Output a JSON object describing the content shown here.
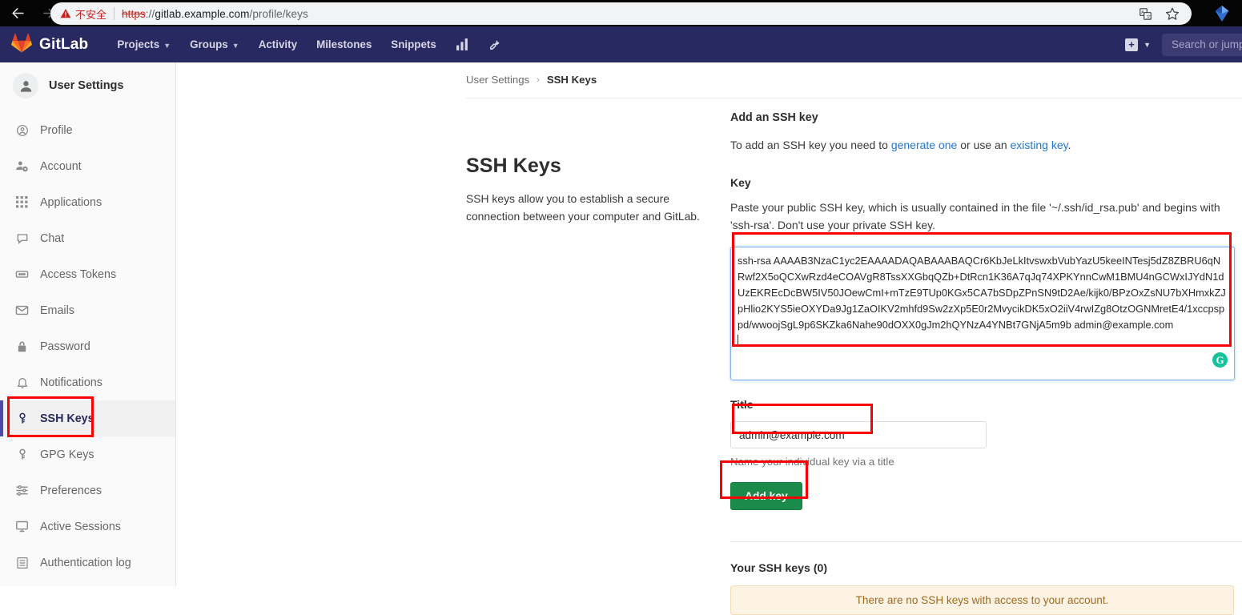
{
  "browser": {
    "back_icon": "back-arrow-icon",
    "forward_icon": "forward-arrow-icon",
    "reload_icon": "reload-icon",
    "security_warning": "不安全",
    "url_scheme": "https",
    "url_separator": "://",
    "url_host": "gitlab.example.com",
    "url_path": "/profile/keys",
    "translate_icon": "translate-icon",
    "bookmark_icon": "star-icon",
    "extension_icon": "extension-diamond-icon"
  },
  "navbar": {
    "brand": "GitLab",
    "logo_icon": "gitlab-tanuki-icon",
    "links": [
      {
        "label": "Projects",
        "caret": "⌄"
      },
      {
        "label": "Groups",
        "caret": "⌄"
      },
      {
        "label": "Activity",
        "caret": ""
      },
      {
        "label": "Milestones",
        "caret": ""
      },
      {
        "label": "Snippets",
        "caret": ""
      }
    ],
    "icon_links": [
      {
        "name": "analytics-chart-icon"
      },
      {
        "name": "wrench-admin-icon"
      }
    ],
    "plus_label": "+",
    "plus_caret": "⌄",
    "search_placeholder": "Search or jump"
  },
  "sidebar": {
    "title": "User Settings",
    "avatar_icon": "user-avatar-icon",
    "items": [
      {
        "label": "Profile",
        "icon": "profile-circle-icon",
        "active": false
      },
      {
        "label": "Account",
        "icon": "account-gear-icon",
        "active": false
      },
      {
        "label": "Applications",
        "icon": "applications-grid-icon",
        "active": false
      },
      {
        "label": "Chat",
        "icon": "chat-bubble-icon",
        "active": false
      },
      {
        "label": "Access Tokens",
        "icon": "access-token-icon",
        "active": false
      },
      {
        "label": "Emails",
        "icon": "envelope-icon",
        "active": false
      },
      {
        "label": "Password",
        "icon": "lock-icon",
        "active": false
      },
      {
        "label": "Notifications",
        "icon": "bell-icon",
        "active": false
      },
      {
        "label": "SSH Keys",
        "icon": "key-icon",
        "active": true
      },
      {
        "label": "GPG Keys",
        "icon": "key-icon",
        "active": false
      },
      {
        "label": "Preferences",
        "icon": "sliders-icon",
        "active": false
      },
      {
        "label": "Active Sessions",
        "icon": "monitor-icon",
        "active": false
      },
      {
        "label": "Authentication log",
        "icon": "log-list-icon",
        "active": false
      }
    ]
  },
  "breadcrumb": {
    "parent": "User Settings",
    "separator": "›",
    "current": "SSH Keys"
  },
  "page": {
    "title": "SSH Keys",
    "description": "SSH keys allow you to establish a secure connection between your computer and GitLab."
  },
  "form": {
    "heading": "Add an SSH key",
    "intro_prefix": "To add an SSH key you need to ",
    "intro_link1": "generate one",
    "intro_middle": " or use an ",
    "intro_link2": "existing key",
    "intro_suffix": ".",
    "key_label": "Key",
    "key_help": "Paste your public SSH key, which is usually contained in the file '~/.ssh/id_rsa.pub' and begins with 'ssh-rsa'. Don't use your private SSH key.",
    "key_value": "ssh-rsa AAAAB3NzaC1yc2EAAAADAQABAAABAQCr6KbJeLkItvswxbVubYazU5keeINTesj5dZ8ZBRU6qNRwf2X5oQCXwRzd4eCOAVgR8TssXXGbqQZb+DtRcn1K36A7qJq74XPKYnnCwM1BMU4nGCWxIJYdN1dUzEKREcDcBW5IV50JOewCmI+mTzE9TUp0KGx5CA7bSDpZPnSN9tD2Ae/kijk0/BPzOxZsNU7bXHmxkZJpHlio2KYS5ieOXYDa9Jg1ZaOIKV2mhfd9Sw2zXp5E0r2MvycikDK5xO2iiV4rwIZg8OtzOGNMretE4/1xccpsppd/wwoojSgL9p6SKZka6Nahe90dOXX0gJm2hQYNzA4YNBt7GNjA5m9b admin@example.com",
    "grammarly_icon": "grammarly-icon",
    "title_label": "Title",
    "title_value": "admin@example.com",
    "title_hint": "Name your individual key via a title",
    "submit_label": "Add key"
  },
  "keys_list": {
    "heading": "Your SSH keys (0)",
    "empty_message": "There are no SSH keys with access to your account."
  },
  "colors": {
    "navbar": "#292961",
    "accent_blue": "#1f78d1",
    "button_green": "#1a8b4a",
    "annotation_red": "#fb0000",
    "warning_bg": "#fdf3e4",
    "warning_text": "#9e6b1f"
  }
}
